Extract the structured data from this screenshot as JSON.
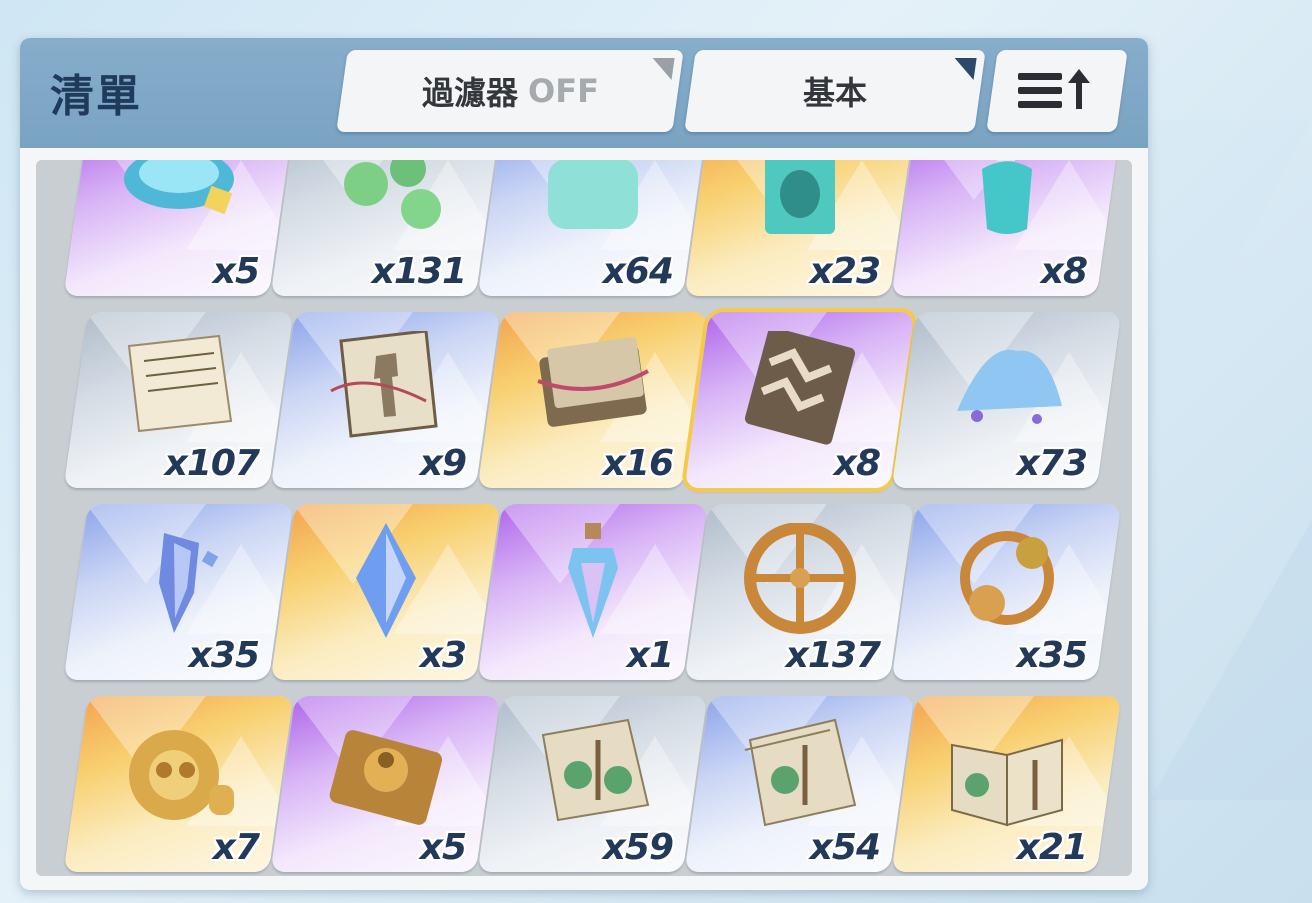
{
  "panel": {
    "title": "清單",
    "filter_label": "過濾器",
    "filter_state": "OFF",
    "sort_mode": "基本",
    "sort_order_icon": "sort-ascending-icon"
  },
  "items": [
    {
      "name": "pet-bowl",
      "count": "x5",
      "rarity": "purple"
    },
    {
      "name": "green-pellets",
      "count": "x131",
      "rarity": "gray"
    },
    {
      "name": "plant-jar",
      "count": "x64",
      "rarity": "blue"
    },
    {
      "name": "specimen-jar",
      "count": "x23",
      "rarity": "gold"
    },
    {
      "name": "potion-bottle",
      "count": "x8",
      "rarity": "purple"
    },
    {
      "name": "ancient-page",
      "count": "x107",
      "rarity": "gray"
    },
    {
      "name": "tied-book",
      "count": "x9",
      "rarity": "blue"
    },
    {
      "name": "bundled-tomes",
      "count": "x16",
      "rarity": "gold"
    },
    {
      "name": "zigzag-book",
      "count": "x8",
      "rarity": "purple",
      "selected": true
    },
    {
      "name": "blue-powder",
      "count": "x73",
      "rarity": "gray"
    },
    {
      "name": "crystal-shard",
      "count": "x35",
      "rarity": "blue"
    },
    {
      "name": "prism-gem",
      "count": "x3",
      "rarity": "gold"
    },
    {
      "name": "corked-vial",
      "count": "x1",
      "rarity": "purple"
    },
    {
      "name": "bronze-wheel",
      "count": "x137",
      "rarity": "gray"
    },
    {
      "name": "gear-cluster",
      "count": "x35",
      "rarity": "blue"
    },
    {
      "name": "golden-mechanism",
      "count": "x7",
      "rarity": "gold"
    },
    {
      "name": "music-box",
      "count": "x5",
      "rarity": "purple"
    },
    {
      "name": "anatomy-sheet",
      "count": "x59",
      "rarity": "gray"
    },
    {
      "name": "anatomy-stack",
      "count": "x54",
      "rarity": "blue"
    },
    {
      "name": "anatomy-book",
      "count": "x21",
      "rarity": "gold"
    }
  ],
  "colors": {
    "header": "#7aa3c2",
    "title_text": "#1f3a5a",
    "count_text": "#23395a",
    "selected_border": "#f5c94a"
  }
}
